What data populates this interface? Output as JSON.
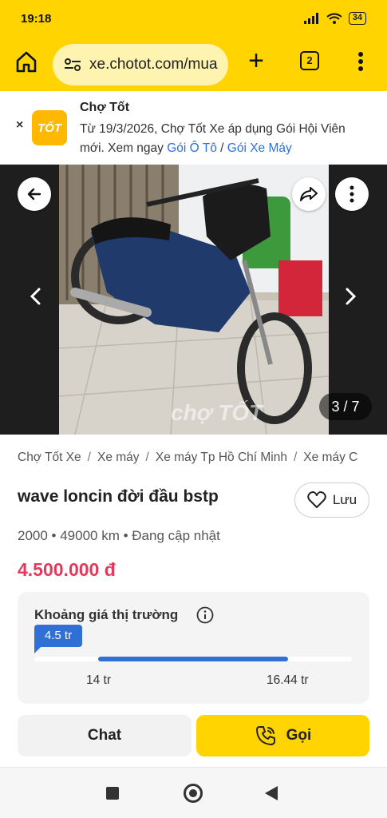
{
  "status_bar": {
    "time": "19:18",
    "battery": "34"
  },
  "browser": {
    "url": "xe.chotot.com/mua",
    "tab_count": "2"
  },
  "banner": {
    "title": "Chợ Tốt",
    "logo_text": "TỐT",
    "text_before": "Từ 19/3/2026, Chợ Tốt Xe áp dụng Gói Hội Viên mới. Xem ngay ",
    "link_car": "Gói Ô Tô",
    "divider": " / ",
    "link_bike": "Gói Xe Máy"
  },
  "gallery": {
    "counter": "3 / 7",
    "watermark": "chợ TỐT"
  },
  "breadcrumb": [
    "Chợ Tốt Xe",
    "Xe máy",
    "Xe máy Tp Hồ Chí Minh",
    "Xe máy C"
  ],
  "listing": {
    "title": "wave loncin đời đầu bstp",
    "save_label": "Lưu",
    "meta": "2000 • 49000 km • Đang cập nhật",
    "price": "4.500.000 đ"
  },
  "market_range": {
    "title": "Khoảng giá thị trường",
    "current_label": "4.5 tr",
    "low_label": "14 tr",
    "high_label": "16.44 tr",
    "fill_start_fraction": 0.2,
    "fill_end_fraction": 0.8
  },
  "actions": {
    "chat_label": "Chat",
    "call_label": "Gọi"
  },
  "colors": {
    "brand_yellow": "#ffd400",
    "price_red": "#e5395c",
    "link_blue": "#2f6fd6"
  }
}
